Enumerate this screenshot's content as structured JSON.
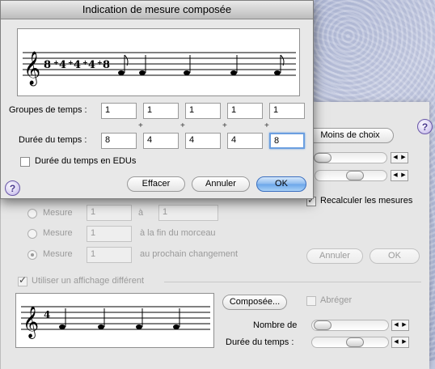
{
  "dialog": {
    "title": "Indication de mesure composée",
    "groups_label": "Groupes de temps :",
    "groups": [
      "1",
      "1",
      "1",
      "1",
      "1"
    ],
    "duration_label": "Durée du temps :",
    "durations": [
      "8",
      "4",
      "4",
      "4",
      "8"
    ],
    "edus_label": "Durée du temps en EDUs",
    "clear_button": "Effacer",
    "cancel_button": "Annuler",
    "ok_button": "OK",
    "help_label": "?"
  },
  "mainwin": {
    "fewer_choices": "Moins de choix",
    "help_label": "?",
    "recalc_label": "Recalculer les mesures",
    "radio_measure_label": "Mesure",
    "radio1": {
      "from": "1",
      "to_label": "à",
      "to": "1"
    },
    "radio2": {
      "value": "1",
      "suffix": "à la fin du morceau"
    },
    "radio3": {
      "value": "1",
      "suffix": "au prochain changement"
    },
    "cancel_button": "Annuler",
    "ok_button": "OK",
    "alt_display_label": "Utiliser un affichage différent",
    "composite_button": "Composée...",
    "abbreviate_label": "Abréger",
    "number_of_label": "Nombre de",
    "beat_duration_label": "Durée du temps :"
  },
  "colors": {
    "accent": "#6aa6ea",
    "help": "#4b3a8e"
  }
}
